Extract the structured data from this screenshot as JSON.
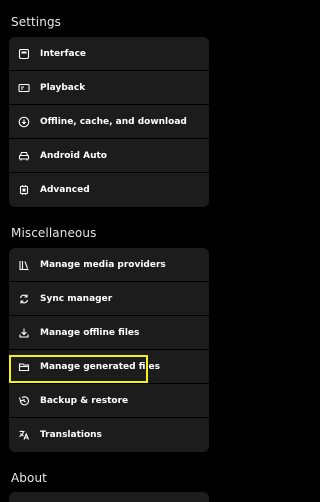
{
  "sections": {
    "settings": {
      "title": "Settings",
      "items": [
        {
          "label": "Interface",
          "icon": "interface-icon"
        },
        {
          "label": "Playback",
          "icon": "playback-icon"
        },
        {
          "label": "Offline, cache, and download",
          "icon": "download-circle-icon"
        },
        {
          "label": "Android Auto",
          "icon": "car-icon"
        },
        {
          "label": "Advanced",
          "icon": "chip-icon"
        }
      ]
    },
    "miscellaneous": {
      "title": "Miscellaneous",
      "items": [
        {
          "label": "Manage media providers",
          "icon": "library-icon"
        },
        {
          "label": "Sync manager",
          "icon": "sync-icon"
        },
        {
          "label": "Manage offline files",
          "icon": "download-icon"
        },
        {
          "label": "Manage generated files",
          "icon": "folder-icon"
        },
        {
          "label": "Backup & restore",
          "icon": "restore-icon"
        },
        {
          "label": "Translations",
          "icon": "translate-icon"
        }
      ]
    },
    "about": {
      "title": "About"
    }
  },
  "highlight_color": "#f5f21b"
}
